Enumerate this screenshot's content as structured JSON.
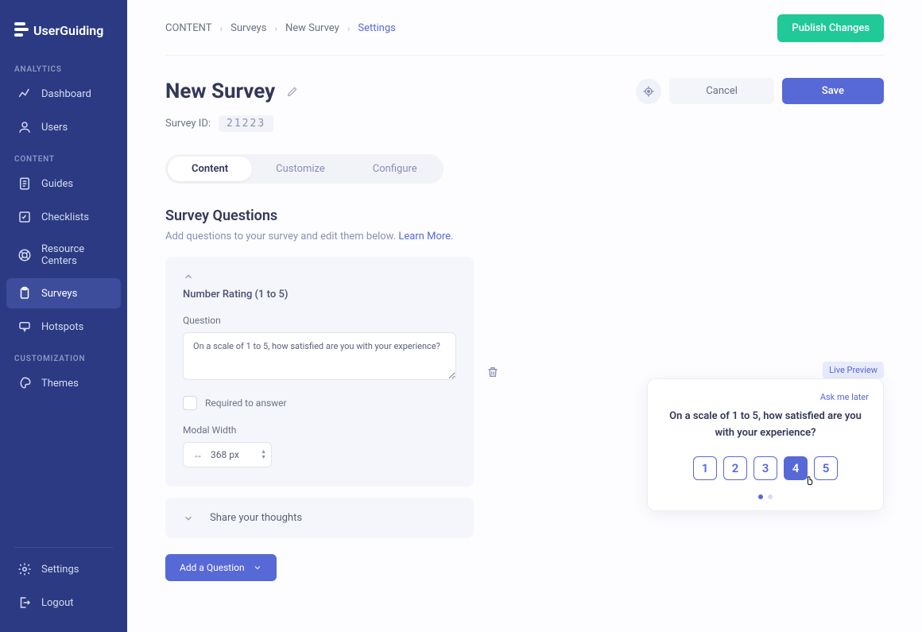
{
  "brand": "UserGuiding",
  "sidebar": {
    "analytics_heading": "ANALYTICS",
    "content_heading": "CONTENT",
    "customization_heading": "CUSTOMIZATION",
    "items": {
      "dashboard": "Dashboard",
      "users": "Users",
      "guides": "Guides",
      "checklists": "Checklists",
      "resource_centers": "Resource Centers",
      "surveys": "Surveys",
      "hotspots": "Hotspots",
      "themes": "Themes",
      "settings": "Settings",
      "logout": "Logout"
    }
  },
  "breadcrumb": {
    "content": "CONTENT",
    "surveys": "Surveys",
    "new_survey": "New Survey",
    "settings": "Settings"
  },
  "publish_btn": "Publish Changes",
  "page_title": "New Survey",
  "cancel_btn": "Cancel",
  "save_btn": "Save",
  "survey_id_label": "Survey ID:",
  "survey_id": "21223",
  "tabs": {
    "content": "Content",
    "customize": "Customize",
    "configure": "Configure"
  },
  "section": {
    "title": "Survey Questions",
    "desc": "Add questions to your survey and edit them below. ",
    "learn_more": "Learn More."
  },
  "question_card": {
    "type": "Number Rating (1 to 5)",
    "label": "Question",
    "text": "On a scale of 1 to 5, how satisfied are you with your experience?",
    "required_label": "Required to answer",
    "modal_width_label": "Modal Width",
    "modal_width_value": "368 px"
  },
  "collapsed_question": "Share your thoughts",
  "add_question_btn": "Add a Question",
  "preview": {
    "badge": "Live Preview",
    "ask_later": "Ask me later",
    "question": "On a scale of 1 to 5, how satisfied are you with your experience?",
    "options": [
      "1",
      "2",
      "3",
      "4",
      "5"
    ],
    "selected": "4"
  }
}
